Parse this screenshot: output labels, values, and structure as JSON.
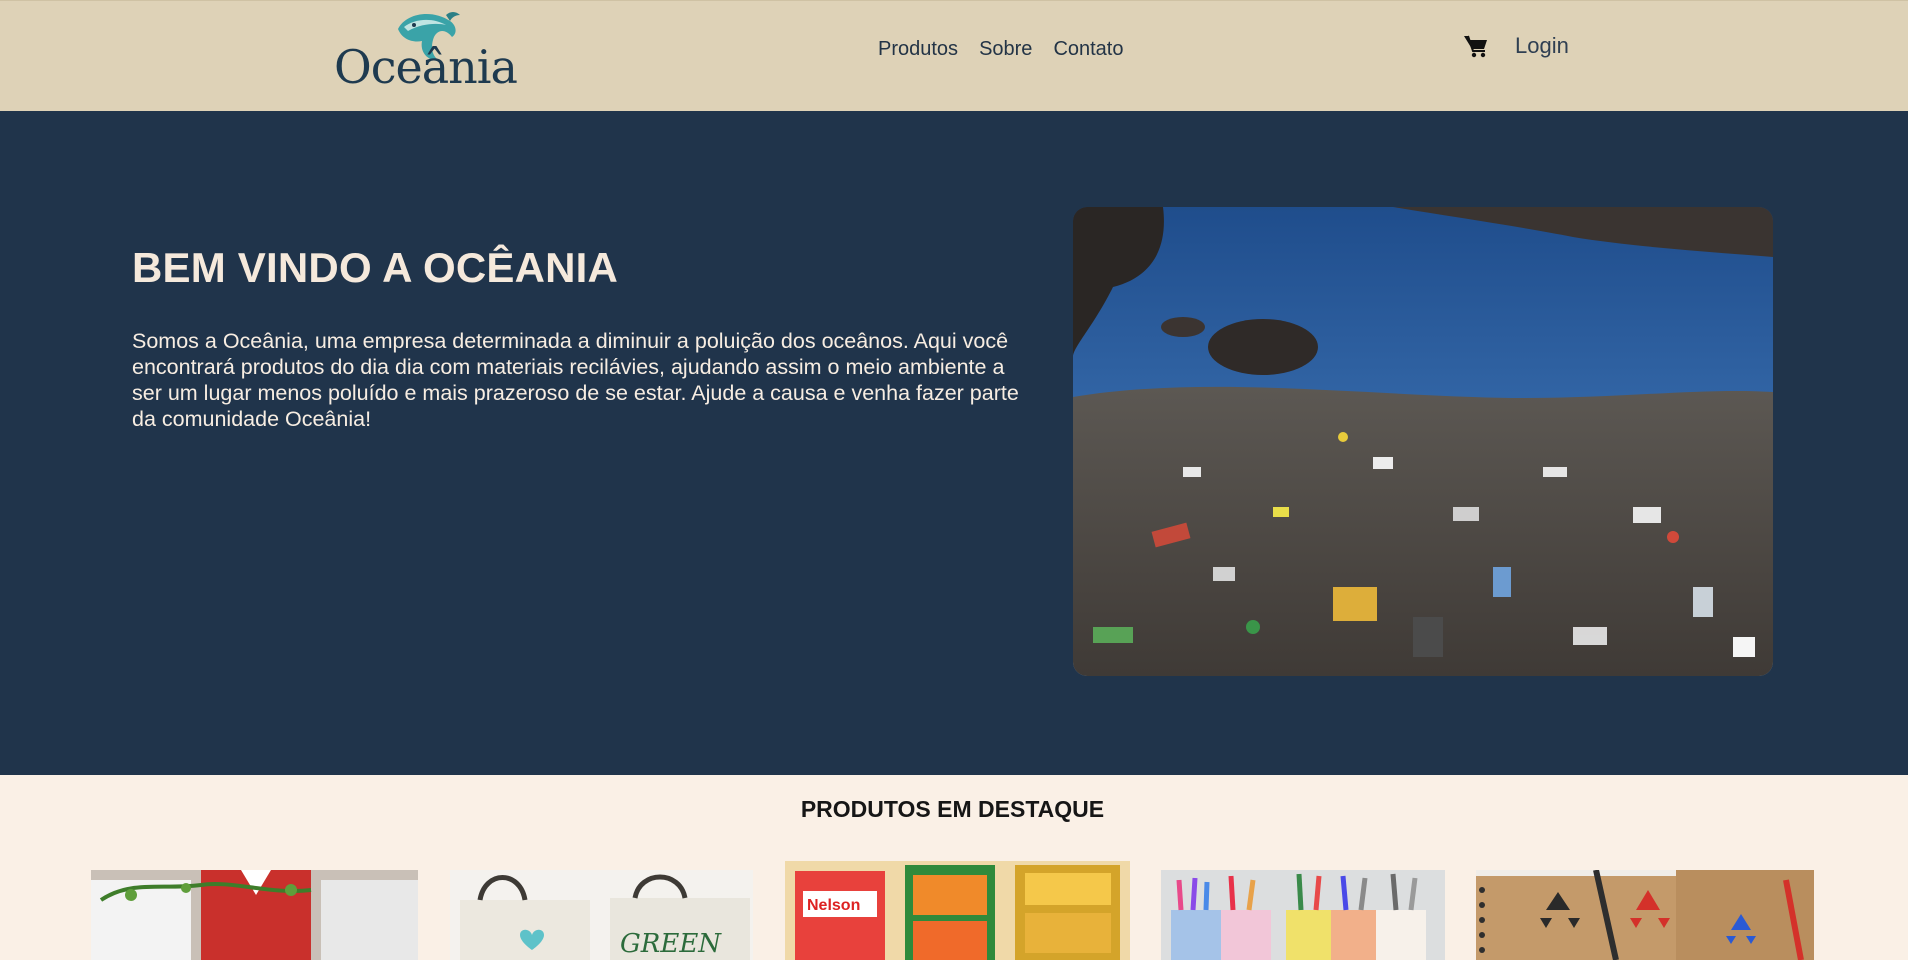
{
  "header": {
    "logo_text": "Oceânia",
    "nav": [
      {
        "label": "Produtos"
      },
      {
        "label": "Sobre"
      },
      {
        "label": "Contato"
      }
    ],
    "cart_icon": "cart-icon",
    "login_label": "Login"
  },
  "hero": {
    "title": "BEM VINDO A OCÊANIA",
    "text": "Somos a Oceânia, uma empresa determinada a diminuir a poluição dos oceânos. Aqui você encontrará produtos do dia dia com materiais recilávies, ajudando assim o meio ambiente a ser um lugar menos poluído e mais prazeroso de se estar. Ajude a causa e venha fazer parte da comunidade Oceânia!"
  },
  "products": {
    "title": "PRODUTOS EM DESTAQUE",
    "cards": [
      {
        "name": "product-1",
        "image_text": ""
      },
      {
        "name": "product-2",
        "image_text": "GREEN"
      },
      {
        "name": "product-3",
        "image_text": "Nelson"
      },
      {
        "name": "product-4",
        "image_text": ""
      },
      {
        "name": "product-5",
        "image_text": ""
      }
    ]
  },
  "colors": {
    "header_bg": "#ded2b7",
    "hero_bg": "#20344b",
    "hero_text": "#f5e9dc",
    "page_bg": "#faf0e6",
    "brand": "#1e3a4f",
    "accent": "#3aa3a8"
  }
}
